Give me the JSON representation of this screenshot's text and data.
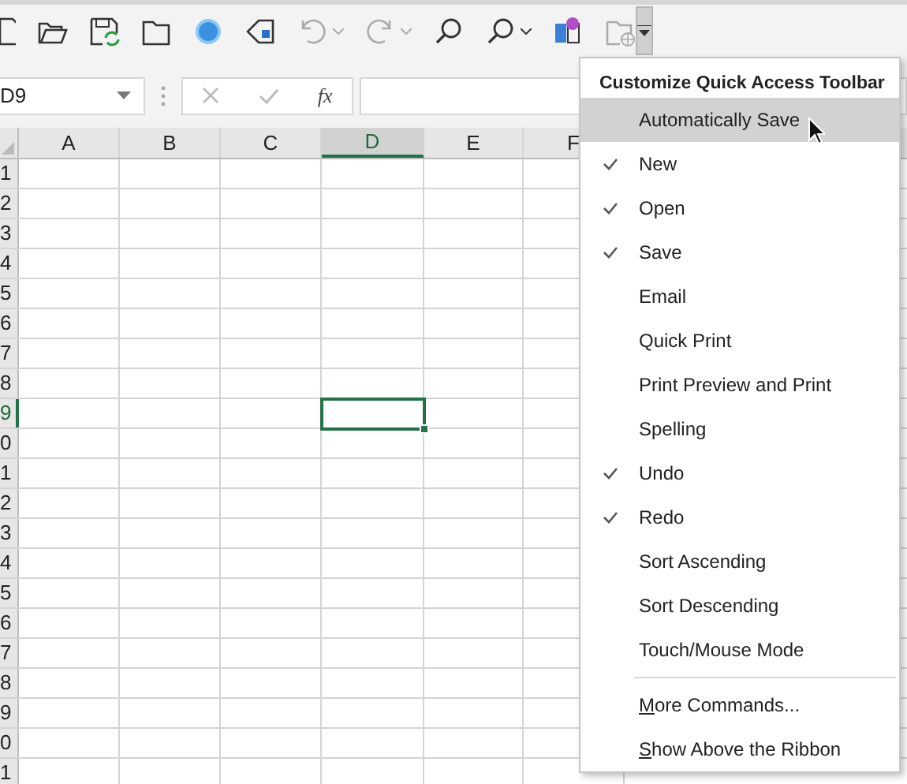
{
  "toolbar": [
    {
      "kind": "new"
    },
    {
      "kind": "open"
    },
    {
      "kind": "save"
    },
    {
      "kind": "folder"
    },
    {
      "kind": "circle"
    },
    {
      "kind": "tag"
    },
    {
      "kind": "undo",
      "disabled": true,
      "dropdown": true
    },
    {
      "kind": "redo",
      "disabled": true,
      "dropdown": true
    },
    {
      "kind": "search"
    },
    {
      "kind": "search",
      "dropdown": true
    },
    {
      "kind": "cubes"
    },
    {
      "kind": "folder-globe",
      "disabled": true
    },
    {
      "kind": "customize",
      "selected": true
    }
  ],
  "name_box": {
    "value": "D9"
  },
  "formula_bar": {
    "function_label": "fx"
  },
  "grid": {
    "columns": [
      {
        "label": "A",
        "selected": false
      },
      {
        "label": "B",
        "selected": false
      },
      {
        "label": "C",
        "selected": false
      },
      {
        "label": "D",
        "selected": true
      },
      {
        "label": "E",
        "selected": false
      },
      {
        "label": "F",
        "selected": false
      }
    ],
    "rows": [
      {
        "label": "1",
        "selected": false
      },
      {
        "label": "2",
        "selected": false
      },
      {
        "label": "3",
        "selected": false
      },
      {
        "label": "4",
        "selected": false
      },
      {
        "label": "5",
        "selected": false
      },
      {
        "label": "6",
        "selected": false
      },
      {
        "label": "7",
        "selected": false
      },
      {
        "label": "8",
        "selected": false
      },
      {
        "label": "9",
        "selected": true
      },
      {
        "label": "0",
        "selected": false
      },
      {
        "label": "1",
        "selected": false
      },
      {
        "label": "2",
        "selected": false
      },
      {
        "label": "3",
        "selected": false
      },
      {
        "label": "4",
        "selected": false
      },
      {
        "label": "5",
        "selected": false
      },
      {
        "label": "6",
        "selected": false
      },
      {
        "label": "7",
        "selected": false
      },
      {
        "label": "8",
        "selected": false
      },
      {
        "label": "9",
        "selected": false
      },
      {
        "label": "0",
        "selected": false
      },
      {
        "label": "1",
        "selected": false
      }
    ]
  },
  "menu": {
    "title": "Customize Quick Access Toolbar",
    "items": [
      {
        "kind": "option",
        "label": "Automatically Save",
        "checked": false,
        "selected": true
      },
      {
        "kind": "option",
        "label": "New",
        "checked": true,
        "selected": false
      },
      {
        "kind": "option",
        "label": "Open",
        "checked": true,
        "selected": false
      },
      {
        "kind": "option",
        "label": "Save",
        "checked": true,
        "selected": false
      },
      {
        "kind": "option",
        "label": "Email",
        "checked": false,
        "selected": false
      },
      {
        "kind": "option",
        "label": "Quick Print",
        "checked": false,
        "selected": false
      },
      {
        "kind": "option",
        "label": "Print Preview and Print",
        "checked": false,
        "selected": false
      },
      {
        "kind": "option",
        "label": "Spelling",
        "checked": false,
        "selected": false
      },
      {
        "kind": "option",
        "label": "Undo",
        "checked": true,
        "selected": false
      },
      {
        "kind": "option",
        "label": "Redo",
        "checked": true,
        "selected": false
      },
      {
        "kind": "option",
        "label": "Sort Ascending",
        "checked": false,
        "selected": false
      },
      {
        "kind": "option",
        "label": "Sort Descending",
        "checked": false,
        "selected": false
      },
      {
        "kind": "option",
        "label": "Touch/Mouse Mode",
        "checked": false,
        "selected": false
      },
      {
        "kind": "separator"
      },
      {
        "kind": "command",
        "access_key": "M",
        "label": "ore Commands...",
        "selected": false
      },
      {
        "kind": "command",
        "access_key": "S",
        "label": "how Above the Ribbon",
        "selected": false
      }
    ]
  }
}
